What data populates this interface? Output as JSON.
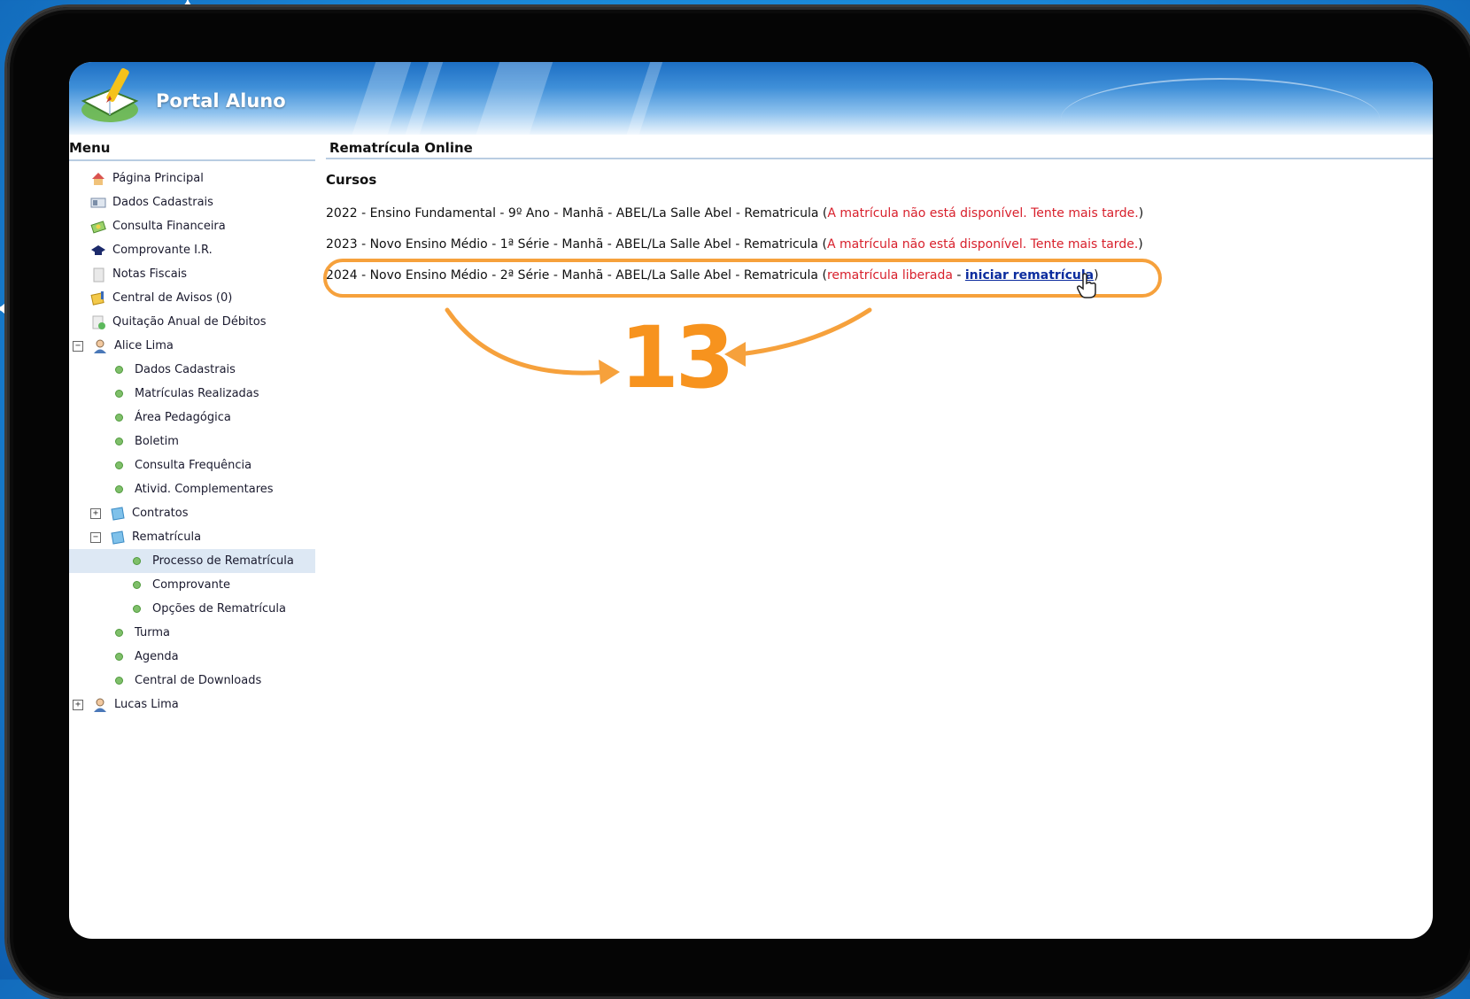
{
  "portal": {
    "title": "Portal Aluno"
  },
  "menu": {
    "title": "Menu",
    "items": [
      {
        "label": "Página Principal",
        "icon": "home-icon"
      },
      {
        "label": "Dados Cadastrais",
        "icon": "id-card-icon"
      },
      {
        "label": "Consulta Financeira",
        "icon": "money-icon"
      },
      {
        "label": "Comprovante I.R.",
        "icon": "receipt-icon"
      },
      {
        "label": "Notas Fiscais",
        "icon": "document-icon"
      },
      {
        "label": "Central de Avisos (0)",
        "icon": "notice-icon"
      },
      {
        "label": "Quitação Anual de Débitos",
        "icon": "document-check-icon"
      },
      {
        "label": "Alice Lima",
        "icon": "user-icon"
      },
      {
        "label": "Dados Cadastrais"
      },
      {
        "label": "Matrículas Realizadas"
      },
      {
        "label": "Área Pedagógica"
      },
      {
        "label": "Boletim"
      },
      {
        "label": "Consulta Frequência"
      },
      {
        "label": "Ativid. Complementares"
      },
      {
        "label": "Contratos",
        "icon": "folder-icon"
      },
      {
        "label": "Rematrícula",
        "icon": "folder-icon"
      },
      {
        "label": "Processo de Rematrícula"
      },
      {
        "label": "Comprovante"
      },
      {
        "label": "Opções de Rematrícula"
      },
      {
        "label": "Turma"
      },
      {
        "label": "Agenda"
      },
      {
        "label": "Central de Downloads"
      },
      {
        "label": "Lucas Lima",
        "icon": "user-icon"
      }
    ]
  },
  "main": {
    "title": "Rematrícula Online",
    "section": "Cursos",
    "courses": [
      {
        "text": "2022 - Ensino Fundamental - 9º Ano - Manhã - ABEL/La Salle Abel - Rematricula",
        "open": "(",
        "status": "A matrícula não está disponível. Tente mais tarde.",
        "close": ")"
      },
      {
        "text": "2023 - Novo Ensino Médio - 1ª Série - Manhã - ABEL/La Salle Abel - Rematricula",
        "open": "(",
        "status": "A matrícula não está disponível. Tente mais tarde.",
        "close": ")"
      },
      {
        "text": "2024 - Novo Ensino Médio - 2ª Série - Manhã - ABEL/La Salle Abel - Rematricula",
        "open": "(",
        "status": "rematrícula liberada",
        "separator": " - ",
        "link": "iniciar rematrícula",
        "close": ")"
      }
    ]
  },
  "annotation": {
    "step_number": "13",
    "color": "#f7931e"
  },
  "colors": {
    "status_red": "#d8202c",
    "link_blue": "#0b2c9e",
    "accent_orange": "#f6a13c"
  }
}
